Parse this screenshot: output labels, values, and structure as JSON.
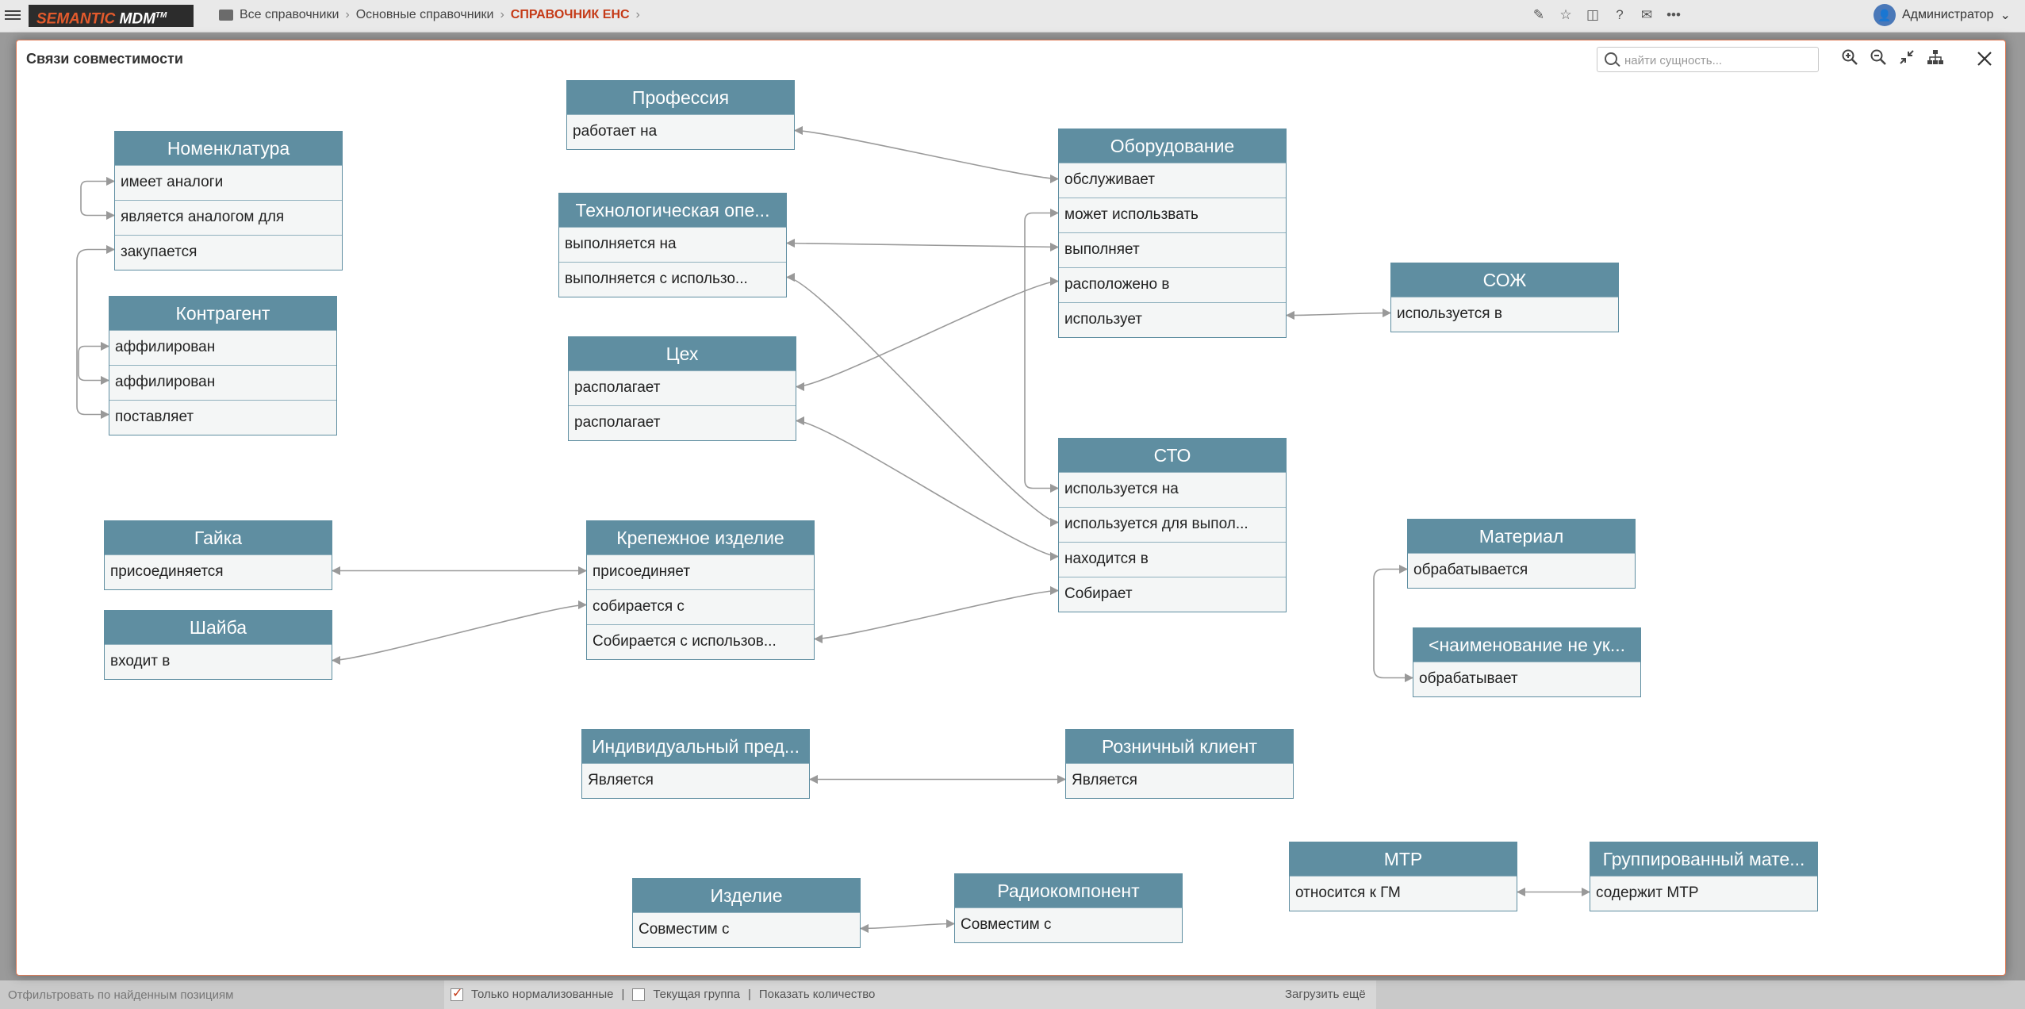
{
  "app": {
    "logo_main": "SEMANTIC",
    "logo_sub": "MDM",
    "logo_tm": "TM",
    "breadcrumb": [
      "Все справочники",
      "Основные справочники",
      "СПРАВОЧНИК ЕНС"
    ],
    "user": "Администратор"
  },
  "toolbar_icons": [
    "pencil-icon",
    "star-icon",
    "columns-icon",
    "help-icon",
    "mail-icon",
    "more-icon"
  ],
  "modal": {
    "title": "Связи совместимости",
    "search_placeholder": "найти сущность..."
  },
  "bottom": {
    "filter_placeholder": "Отфильтровать по найденным позициям",
    "only_normalized": "Только нормализованные",
    "current_group": "Текущая группа",
    "show_count": "Показать количество",
    "load_more": "Загрузить ещё"
  },
  "entities": [
    {
      "title": "Номенклатура",
      "rows": [
        "имеет аналоги",
        "является аналогом для",
        "закупается"
      ]
    },
    {
      "title": "Контрагент",
      "rows": [
        "аффилирован",
        "аффилирован",
        "поставляет"
      ]
    },
    {
      "title": "Профессия",
      "rows": [
        "работает на"
      ]
    },
    {
      "title": "Технологическая опе...",
      "rows": [
        "выполняется на",
        "выполняется с использо..."
      ]
    },
    {
      "title": "Цех",
      "rows": [
        "располагает",
        "располагает"
      ]
    },
    {
      "title": "Оборудование",
      "rows": [
        "обслуживает",
        "может использвать",
        "выполняет",
        "расположено в",
        "использует"
      ]
    },
    {
      "title": "СОЖ",
      "rows": [
        "используется в"
      ]
    },
    {
      "title": "СТО",
      "rows": [
        "используется на",
        "используется для выпол...",
        "находится в",
        "Собирает"
      ]
    },
    {
      "title": "Гайка",
      "rows": [
        "присоединяется"
      ]
    },
    {
      "title": "Шайба",
      "rows": [
        "входит в"
      ]
    },
    {
      "title": "Крепежное изделие",
      "rows": [
        "присоединяет",
        "собирается с",
        "Собирается с использов..."
      ]
    },
    {
      "title": "Материал",
      "rows": [
        "обрабатывается"
      ]
    },
    {
      "title": "<наименование не ук...",
      "rows": [
        "обрабатывает"
      ]
    },
    {
      "title": "Индивидуальный пред...",
      "rows": [
        "Является"
      ]
    },
    {
      "title": "Розничный клиент",
      "rows": [
        "Является"
      ]
    },
    {
      "title": "МТР",
      "rows": [
        "относится к ГМ"
      ]
    },
    {
      "title": "Группированный мате...",
      "rows": [
        "содержит МТР"
      ]
    },
    {
      "title": "Изделие",
      "rows": [
        "Совместим с"
      ]
    },
    {
      "title": "Радиокомпонент",
      "rows": [
        "Совместим с"
      ]
    }
  ]
}
